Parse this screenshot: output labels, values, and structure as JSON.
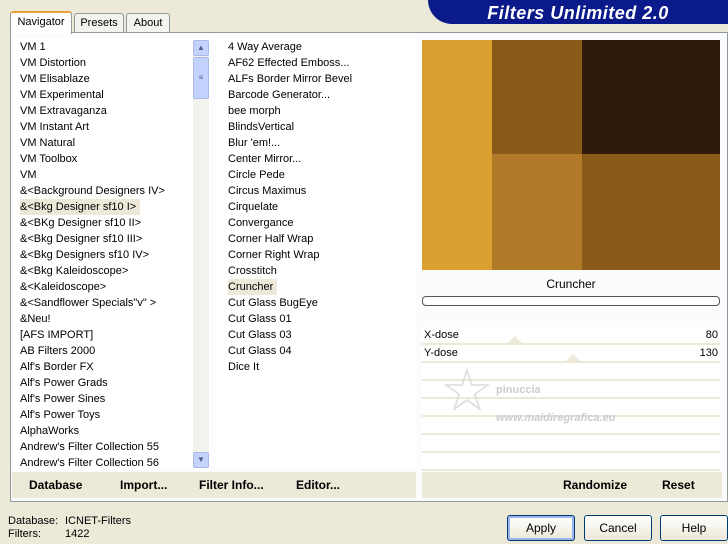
{
  "title": "Filters Unlimited 2.0",
  "tabs": [
    "Navigator",
    "Presets",
    "About"
  ],
  "categories": [
    "VM 1",
    "VM Distortion",
    "VM Elisablaze",
    "VM Experimental",
    "VM Extravaganza",
    "VM Instant Art",
    "VM Natural",
    "VM Toolbox",
    "VM",
    "&<Background Designers IV>",
    "&<Bkg Designer sf10 I>",
    "&<BKg Designer sf10 II>",
    "&<Bkg Designer sf10 III>",
    "&<Bkg Designers sf10 IV>",
    "&<Bkg Kaleidoscope>",
    "&<Kaleidoscope>",
    "&<Sandflower Specials\"v\" >",
    "&Neu!",
    "[AFS IMPORT]",
    "AB Filters 2000",
    "Alf's Border FX",
    "Alf's Power Grads",
    "Alf's Power Sines",
    "Alf's Power Toys",
    "AlphaWorks",
    "Andrew's Filter Collection 55",
    "Andrew's Filter Collection 56"
  ],
  "selected_category": "&<Bkg Designer sf10 I>",
  "filters": [
    "4 Way Average",
    "AF62 Effected Emboss...",
    "ALFs Border Mirror Bevel",
    "Barcode Generator...",
    "bee morph",
    "BlindsVertical",
    "Blur 'em!...",
    "Center Mirror...",
    "Circle Pede",
    "Circus Maximus",
    "Cirquelate",
    "Convergance",
    "Corner Half Wrap",
    "Corner Right Wrap",
    "Crosstitch",
    "Cruncher",
    "Cut Glass  BugEye",
    "Cut Glass 01",
    "Cut Glass 03",
    "Cut Glass 04",
    "Dice It"
  ],
  "selected_filter": "Cruncher",
  "preview": {
    "colors": [
      "#dba030",
      "#8a5a1a",
      "#2e1a0a",
      "#b07a28",
      "#8a5a1a"
    ]
  },
  "filter_name": "Cruncher",
  "params": [
    {
      "label": "X-dose",
      "value": "80"
    },
    {
      "label": "Y-dose",
      "value": "130"
    }
  ],
  "watermark": {
    "line1": "pinuccia",
    "line2": "www.maidiregrafica.eu"
  },
  "left_buttons": [
    "Database",
    "Import...",
    "Filter Info...",
    "Editor..."
  ],
  "right_buttons": [
    "Randomize",
    "Reset"
  ],
  "status": {
    "db_label": "Database:",
    "db_value": "ICNET-Filters",
    "filters_label": "Filters:",
    "filters_value": "1422"
  },
  "dialog_buttons": [
    "Apply",
    "Cancel",
    "Help"
  ]
}
